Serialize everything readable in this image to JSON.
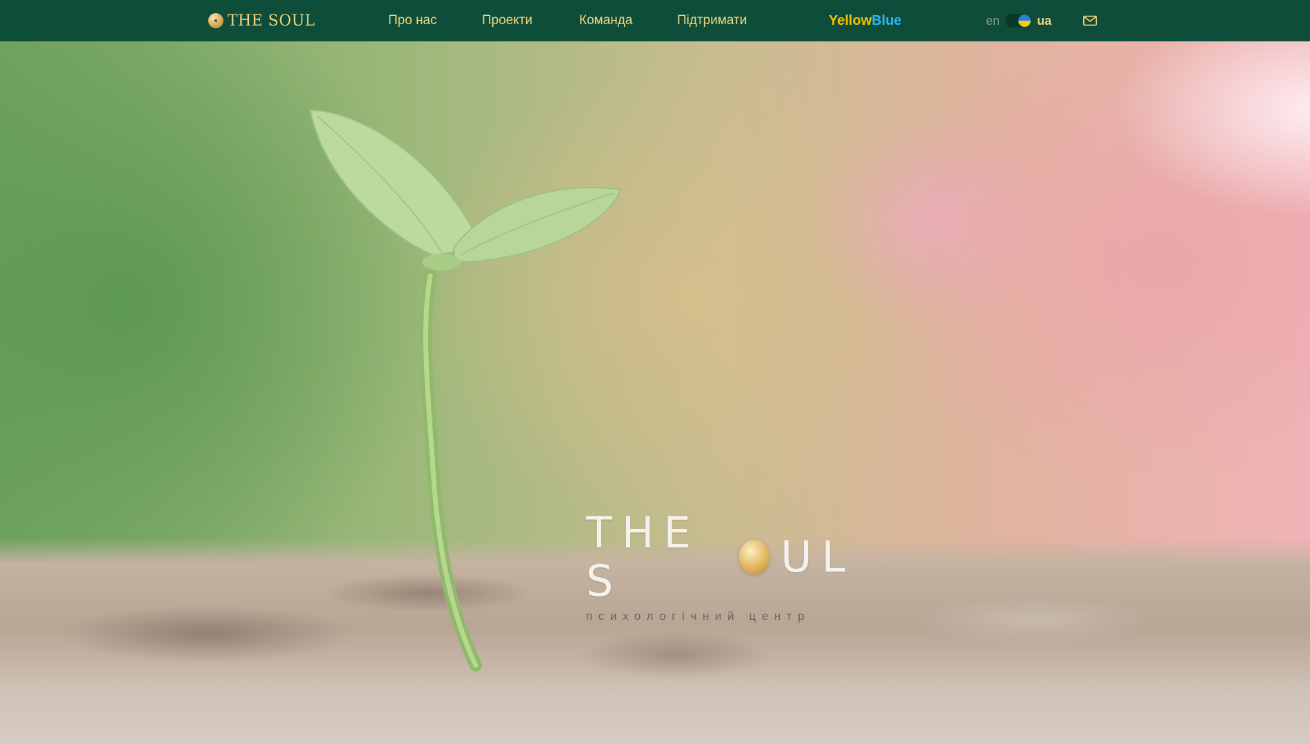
{
  "header": {
    "brand": "THE SOUL",
    "nav": [
      "Про нас",
      "Проекти",
      "Команда",
      "Підтримати"
    ],
    "partner": {
      "yellow": "Yellow",
      "blue": "Blue"
    },
    "language": {
      "inactive": "en",
      "active": "ua"
    }
  },
  "hero": {
    "title_left": "THE S",
    "title_right": "UL",
    "subtitle": "психологічний центр"
  },
  "colors": {
    "header_bg": "#0f4d3b",
    "gold": "#f0d67e",
    "yellow": "#f2c200",
    "blue": "#2fb4ef"
  },
  "icons": [
    "soul-dot-icon",
    "flag-toggle-icon",
    "mail-icon"
  ]
}
